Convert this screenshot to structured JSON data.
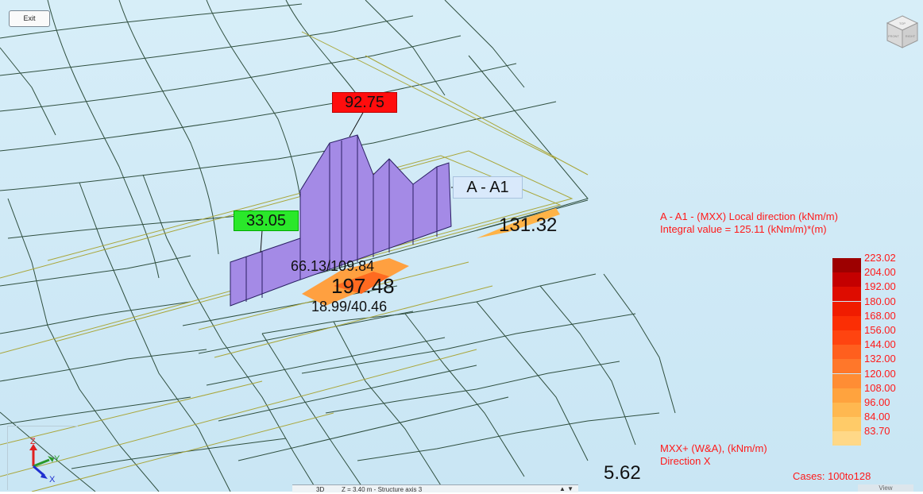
{
  "toolbar": {
    "exit_label": "Exit"
  },
  "view_cube": {
    "face_top": "TOP",
    "face_left": "FRONT",
    "face_right": "RIGHT"
  },
  "diagram": {
    "max_tag": "92.75",
    "min_tag": "33.05",
    "section_tag": "A - A1",
    "hot_value_1": "131.32",
    "mid_pair_top": "66.13/109.84",
    "hot_value_2": "197.48",
    "mid_pair_bottom": "18.99/40.46",
    "corner_value": "5.62"
  },
  "info_panel": {
    "line1": "A - A1 - (MXX) Local direction (kNm/m)",
    "line2": "Integral value = 125.11 (kNm/m)*(m)"
  },
  "legend": {
    "items": [
      {
        "label": "223.02",
        "color": "#9d0000"
      },
      {
        "label": "204.00",
        "color": "#c40000"
      },
      {
        "label": "192.00",
        "color": "#de0c00"
      },
      {
        "label": "180.00",
        "color": "#f01c00"
      },
      {
        "label": "168.00",
        "color": "#fb2e04"
      },
      {
        "label": "156.00",
        "color": "#ff4410"
      },
      {
        "label": "144.00",
        "color": "#ff5f1e"
      },
      {
        "label": "132.00",
        "color": "#ff772a"
      },
      {
        "label": "120.00",
        "color": "#ff8d34"
      },
      {
        "label": "108.00",
        "color": "#ffa33e"
      },
      {
        "label": "96.00",
        "color": "#ffb850"
      },
      {
        "label": "84.00",
        "color": "#ffcb68"
      },
      {
        "label": "83.70",
        "color": "#ffd887"
      }
    ]
  },
  "footer_info": {
    "line1": "MXX+ (W&A), (kNm/m)",
    "line2": "Direction X",
    "cases": "Cases: 100to128"
  },
  "axes": {
    "z": "Z",
    "y": "Y",
    "x": "X"
  },
  "statusbar": {
    "mode": "3D",
    "axis_text": "Z = 3.40 m - Structure axis 3",
    "view_tab": "View"
  }
}
